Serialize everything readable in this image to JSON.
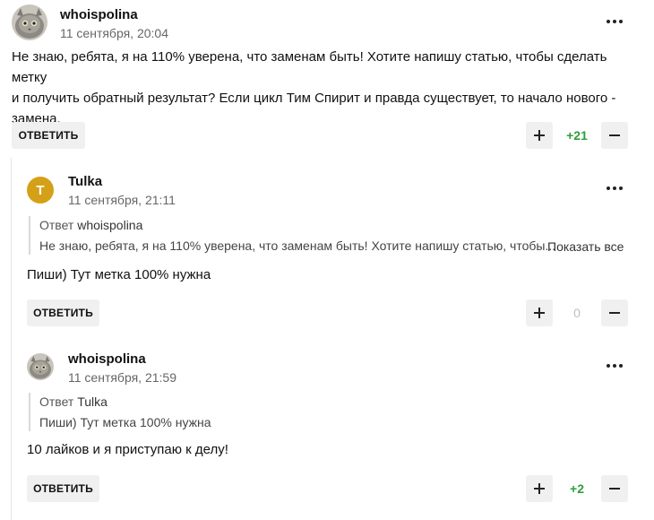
{
  "colors": {
    "positive": "#2e9e3a",
    "neutral": "#bdbdbd",
    "avatar_letter_bg": "#d4a017"
  },
  "icons": {
    "more": "more-horizontal-icon",
    "plus": "plus-icon",
    "minus": "minus-icon"
  },
  "comments": [
    {
      "author": "whoispolina",
      "date": "11 сентября, 20:04",
      "text_lines": [
        "Не знаю, ребята, я на 110% уверена, что заменам быть! Хотите напишу статью, чтобы сделать метку",
        "и получить обратный результат? Если цикл Тим Спирит и правда существует, то начало нового -",
        "замена."
      ],
      "reply_label": "ОТВЕТИТЬ",
      "rating": "+21"
    },
    {
      "author": "Tulka",
      "avatar_letter": "T",
      "date": "11 сентября, 21:11",
      "quote_prefix": "Ответ",
      "quote_author": "whoispolina",
      "quote_text": "Не знаю, ребята, я на 110% уверена, что заменам быть! Хотите напишу статью, чтобы...",
      "show_all": "Показать все",
      "text": "Пиши) Тут метка 100% нужна",
      "reply_label": "ОТВЕТИТЬ",
      "rating": "0"
    },
    {
      "author": "whoispolina",
      "date": "11 сентября, 21:59",
      "quote_prefix": "Ответ",
      "quote_author": "Tulka",
      "quote_text": "Пиши) Тут метка 100% нужна",
      "text": "10 лайков и я приступаю к делу!",
      "reply_label": "ОТВЕТИТЬ",
      "rating": "+2"
    }
  ]
}
